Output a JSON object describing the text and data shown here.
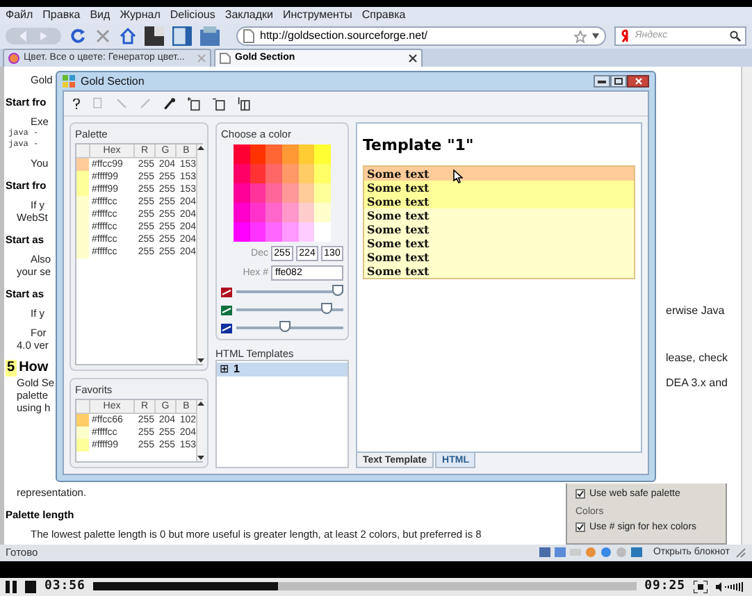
{
  "browser": {
    "menu": [
      "Файл",
      "Правка",
      "Вид",
      "Журнал",
      "Delicious",
      "Закладки",
      "Инструменты",
      "Справка"
    ],
    "url": "http://goldsection.sourceforge.net/",
    "search_placeholder": "Яндекс",
    "tabs": [
      {
        "label": "Цвет. Все о цвете: Генератор цвет...",
        "selected": false
      },
      {
        "label": "Gold Section",
        "selected": true
      }
    ],
    "status": "Готово",
    "tray_label": "Открыть блокнот"
  },
  "page": {
    "left_lines": [
      {
        "kind": "para",
        "text": "Gold"
      },
      {
        "kind": "heading",
        "text": "Start fro"
      },
      {
        "kind": "para",
        "text": "Exe"
      },
      {
        "kind": "code",
        "text": "java -"
      },
      {
        "kind": "code",
        "text": "java -"
      },
      {
        "kind": "para",
        "text": "You"
      },
      {
        "kind": "heading",
        "text": "Start fro"
      },
      {
        "kind": "para",
        "text": "If y"
      },
      {
        "kind": "line",
        "text": "WebSt"
      },
      {
        "kind": "heading",
        "text": "Start as"
      },
      {
        "kind": "para",
        "text": "Also"
      },
      {
        "kind": "line",
        "text": "your se"
      },
      {
        "kind": "heading",
        "text": "Start as"
      },
      {
        "kind": "para",
        "text": "If y"
      },
      {
        "kind": "para",
        "text": "For"
      },
      {
        "kind": "line",
        "text": "4.0 ver"
      },
      {
        "kind": "section",
        "number": "5",
        "text": "How"
      },
      {
        "kind": "line",
        "text": "Gold Se"
      },
      {
        "kind": "line",
        "text": "palette"
      },
      {
        "kind": "line",
        "text": "using h"
      }
    ],
    "below_lines": [
      {
        "kind": "line",
        "text": "representation."
      },
      {
        "kind": "heading",
        "text": "Palette length"
      },
      {
        "kind": "para",
        "text": "The lowest palette length is 0 but more useful is greater length, at least 2 colors, but preferred is 8"
      }
    ],
    "right_lines": [
      "erwise Java",
      "lease, check",
      "DEA 3.x and"
    ],
    "settings": {
      "options": [
        {
          "label": "Use web safe palette",
          "checked": true
        }
      ],
      "group": "Colors",
      "group_options": [
        {
          "label": "Use # sign for hex colors",
          "checked": true
        }
      ]
    }
  },
  "app": {
    "title": "Gold Section",
    "palette": {
      "title": "Palette",
      "columns": [
        "Hex",
        "R",
        "G",
        "B"
      ],
      "rows": [
        {
          "hex": "#ffcc99",
          "r": "255",
          "g": "204",
          "b": "153",
          "color": "#ffcc99"
        },
        {
          "hex": "#ffff99",
          "r": "255",
          "g": "255",
          "b": "153",
          "color": "#ffff99"
        },
        {
          "hex": "#ffff99",
          "r": "255",
          "g": "255",
          "b": "153",
          "color": "#ffff99"
        },
        {
          "hex": "#ffffcc",
          "r": "255",
          "g": "255",
          "b": "204",
          "color": "#ffffcc"
        },
        {
          "hex": "#ffffcc",
          "r": "255",
          "g": "255",
          "b": "204",
          "color": "#ffffcc"
        },
        {
          "hex": "#ffffcc",
          "r": "255",
          "g": "255",
          "b": "204",
          "color": "#ffffcc"
        },
        {
          "hex": "#ffffcc",
          "r": "255",
          "g": "255",
          "b": "204",
          "color": "#ffffcc"
        },
        {
          "hex": "#ffffcc",
          "r": "255",
          "g": "255",
          "b": "204",
          "color": "#ffffcc"
        }
      ]
    },
    "favorites": {
      "title": "Favorits",
      "columns": [
        "Hex",
        "R",
        "G",
        "B"
      ],
      "rows": [
        {
          "hex": "#ffcc66",
          "r": "255",
          "g": "204",
          "b": "102",
          "color": "#ffcc66"
        },
        {
          "hex": "#ffffcc",
          "r": "255",
          "g": "255",
          "b": "204",
          "color": "#ffffcc"
        },
        {
          "hex": "#ffff99",
          "r": "255",
          "g": "255",
          "b": "153",
          "color": "#ffff99"
        }
      ]
    },
    "chooser": {
      "title": "Choose a color",
      "dec_label": "Dec",
      "dec": [
        "255",
        "224",
        "130"
      ],
      "hex_label": "Hex #",
      "hex": "ffe082",
      "sliders": [
        {
          "kind": "red",
          "level": 0.95
        },
        {
          "kind": "green",
          "level": 0.85
        },
        {
          "kind": "blue",
          "level": 0.45
        }
      ]
    },
    "templates": {
      "title": "HTML Templates",
      "items": [
        {
          "expander": "⊞",
          "label": "1",
          "selected": true
        }
      ]
    },
    "preview": {
      "heading": "Template \"1\"",
      "rows": [
        {
          "text": "Some text",
          "color": "#ffcc99"
        },
        {
          "text": "Some text",
          "color": "#ffff99"
        },
        {
          "text": "Some text",
          "color": "#ffff99"
        },
        {
          "text": "Some text",
          "color": "#ffffcc"
        },
        {
          "text": "Some text",
          "color": "#ffffcc"
        },
        {
          "text": "Some text",
          "color": "#ffffcc"
        },
        {
          "text": "Some text",
          "color": "#ffffcc"
        },
        {
          "text": "Some text",
          "color": "#ffffcc"
        }
      ]
    },
    "tabs": [
      {
        "label": "Text Template",
        "selected": false
      },
      {
        "label": "HTML",
        "selected": true
      }
    ]
  },
  "player": {
    "elapsed": "03:56",
    "total": "09:25",
    "level": 0.34
  }
}
